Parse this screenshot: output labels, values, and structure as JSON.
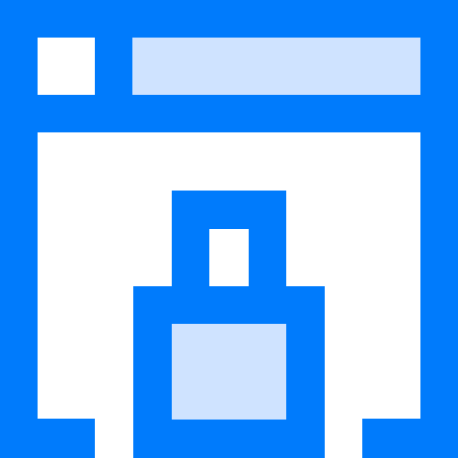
{
  "icon": {
    "name": "secure-browser-window-icon",
    "colors": {
      "primary": "#007bfc",
      "secondary": "#cfe3ff",
      "background": "#ffffff"
    }
  }
}
